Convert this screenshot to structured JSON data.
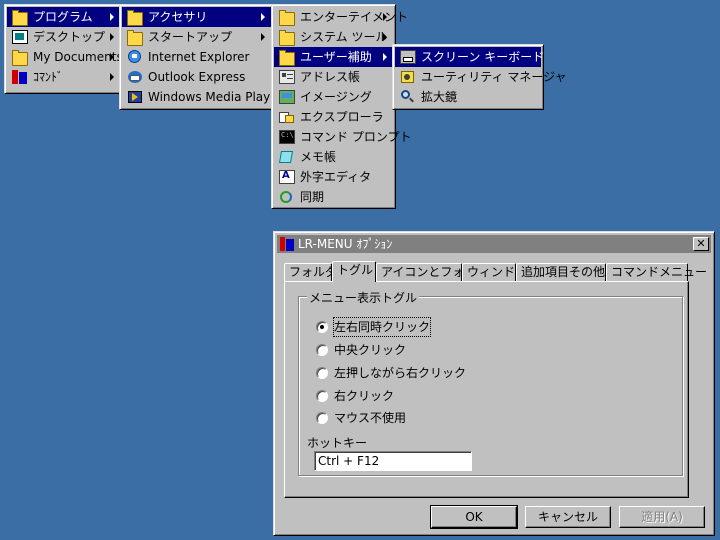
{
  "menu1": {
    "items": [
      {
        "label": "プログラム",
        "icon": "folder-icon"
      },
      {
        "label": "デスクトップ",
        "icon": "desktop-icon"
      },
      {
        "label": "My Documents",
        "icon": "folder-icon"
      },
      {
        "label": "ｺﾏﾝﾄﾞ",
        "icon": "lr-menu-icon"
      }
    ]
  },
  "menu2": {
    "items": [
      {
        "label": "アクセサリ",
        "icon": "folder-icon"
      },
      {
        "label": "スタートアップ",
        "icon": "folder-icon"
      },
      {
        "label": "Internet Explorer",
        "icon": "internet-explorer-icon"
      },
      {
        "label": "Outlook Express",
        "icon": "outlook-express-icon"
      },
      {
        "label": "Windows Media Player",
        "icon": "media-player-icon"
      }
    ]
  },
  "menu3": {
    "items": [
      {
        "label": "エンターテイメント",
        "icon": "folder-icon"
      },
      {
        "label": "システム ツール",
        "icon": "folder-icon"
      },
      {
        "label": "ユーザー補助",
        "icon": "folder-icon"
      },
      {
        "label": "アドレス帳",
        "icon": "address-book-icon"
      },
      {
        "label": "イメージング",
        "icon": "imaging-icon"
      },
      {
        "label": "エクスプローラ",
        "icon": "explorer-icon"
      },
      {
        "label": "コマンド プロンプト",
        "icon": "command-prompt-icon"
      },
      {
        "label": "メモ帳",
        "icon": "notepad-icon"
      },
      {
        "label": "外字エディタ",
        "icon": "font-editor-icon"
      },
      {
        "label": "同期",
        "icon": "sync-icon"
      }
    ]
  },
  "menu4": {
    "items": [
      {
        "label": "スクリーン キーボード",
        "icon": "keyboard-icon"
      },
      {
        "label": "ユーティリティ マネージャ",
        "icon": "utility-manager-icon"
      },
      {
        "label": "拡大鏡",
        "icon": "magnifier-icon"
      }
    ]
  },
  "dialog": {
    "title": "LR-MENU ｵﾌﾟｼｮﾝ",
    "tabs": [
      "フォルダ",
      "トグル",
      "アイコンとフォント",
      "ウィンドウ",
      "追加項目その他",
      "コマンドメニュー"
    ],
    "active_tab": "トグル",
    "group_label": "メニュー表示トグル",
    "radios": [
      {
        "label": "左右同時クリック",
        "checked": true
      },
      {
        "label": "中央クリック",
        "checked": false
      },
      {
        "label": "左押しながら右クリック",
        "checked": false
      },
      {
        "label": "右クリック",
        "checked": false
      },
      {
        "label": "マウス不使用",
        "checked": false
      }
    ],
    "hotkey_label": "ホットキー",
    "hotkey_value": "Ctrl + F12",
    "ok_label": "OK",
    "cancel_label": "キャンセル",
    "apply_label": "適用(A)"
  },
  "colors": {
    "desktop": "#3a6ea5",
    "menu_bg": "#c0c0c0",
    "selection": "#000080",
    "inactive_title": "#808080"
  }
}
